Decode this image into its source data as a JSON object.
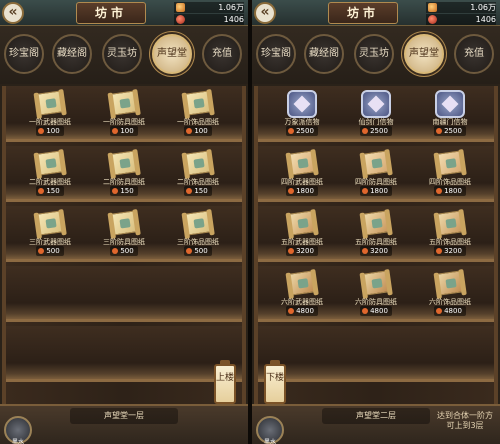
{
  "left": {
    "topbar": {
      "title": "坊市",
      "currency_1": "1.06万",
      "currency_2": "1406"
    },
    "tabs": [
      "珍宝阁",
      "藏经阁",
      "灵玉坊",
      "声望堂",
      "充值"
    ],
    "active_tab": "声望堂",
    "shelves": [
      [
        {
          "name": "一阶武器图纸",
          "price": "100",
          "icon": "scroll"
        },
        {
          "name": "一阶防具图纸",
          "price": "100",
          "icon": "scroll"
        },
        {
          "name": "一阶饰品图纸",
          "price": "100",
          "icon": "scroll"
        }
      ],
      [
        {
          "name": "二阶武器图纸",
          "price": "150",
          "icon": "scroll"
        },
        {
          "name": "二阶防具图纸",
          "price": "150",
          "icon": "scroll"
        },
        {
          "name": "二阶饰品图纸",
          "price": "150",
          "icon": "scroll"
        }
      ],
      [
        {
          "name": "三阶武器图纸",
          "price": "500",
          "icon": "scroll"
        },
        {
          "name": "三阶防具图纸",
          "price": "500",
          "icon": "scroll"
        },
        {
          "name": "三阶饰品图纸",
          "price": "500",
          "icon": "scroll"
        }
      ]
    ],
    "floor_label": "声望堂一层",
    "lantern_label": "上楼",
    "avatar_label": "黑水"
  },
  "right": {
    "topbar": {
      "title": "坊市",
      "currency_1": "1.06万",
      "currency_2": "1406"
    },
    "tabs": [
      "珍宝阁",
      "藏经阁",
      "灵玉坊",
      "声望堂",
      "充值"
    ],
    "active_tab": "声望堂",
    "shelves": [
      [
        {
          "name": "万象派信物",
          "price": "2500",
          "icon": "badge"
        },
        {
          "name": "仙剑门信物",
          "price": "2500",
          "icon": "badge"
        },
        {
          "name": "南疆门信物",
          "price": "2500",
          "icon": "badge"
        }
      ],
      [
        {
          "name": "四阶武器图纸",
          "price": "1800",
          "icon": "scroll"
        },
        {
          "name": "四阶防具图纸",
          "price": "1800",
          "icon": "scroll"
        },
        {
          "name": "四阶饰品图纸",
          "price": "1800",
          "icon": "scroll"
        }
      ],
      [
        {
          "name": "五阶武器图纸",
          "price": "3200",
          "icon": "scroll"
        },
        {
          "name": "五阶防具图纸",
          "price": "3200",
          "icon": "scroll"
        },
        {
          "name": "五阶饰品图纸",
          "price": "3200",
          "icon": "scroll"
        }
      ],
      [
        {
          "name": "六阶武器图纸",
          "price": "4800",
          "icon": "scroll"
        },
        {
          "name": "六阶防具图纸",
          "price": "4800",
          "icon": "scroll"
        },
        {
          "name": "六阶饰品图纸",
          "price": "4800",
          "icon": "scroll"
        }
      ]
    ],
    "floor_label": "声望堂二层",
    "lantern_label": "下楼",
    "hint": "达到合体一阶方可上到3层",
    "avatar_label": "黑水"
  }
}
